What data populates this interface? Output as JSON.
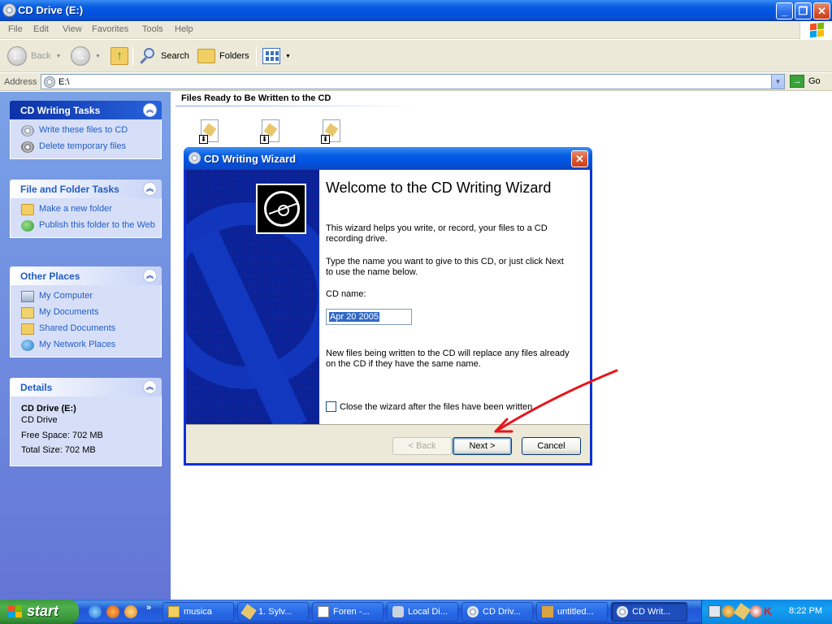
{
  "window": {
    "title": "CD Drive (E:)"
  },
  "menu": [
    "File",
    "Edit",
    "View",
    "Favorites",
    "Tools",
    "Help"
  ],
  "toolbar": {
    "back": "Back",
    "search": "Search",
    "folders": "Folders"
  },
  "address": {
    "label": "Address",
    "value": "E:\\",
    "go": "Go"
  },
  "taskpane": {
    "cd_tasks": {
      "title": "CD Writing Tasks",
      "items": [
        "Write these files to CD",
        "Delete temporary files"
      ]
    },
    "file_tasks": {
      "title": "File and Folder Tasks",
      "items": [
        "Make a new folder",
        "Publish this folder to the Web"
      ]
    },
    "other_places": {
      "title": "Other Places",
      "items": [
        "My Computer",
        "My Documents",
        "Shared Documents",
        "My Network Places"
      ]
    },
    "details": {
      "title": "Details",
      "name": "CD Drive (E:)",
      "type": "CD Drive",
      "free": "Free Space: 702 MB",
      "total": "Total Size: 702 MB"
    }
  },
  "content": {
    "group_header": "Files Ready to Be Written to the CD"
  },
  "wizard": {
    "title": "CD Writing Wizard",
    "heading": "Welcome to the CD Writing Wizard",
    "intro": "This wizard helps you write, or record, your files to a CD recording drive.",
    "instructions": "Type the name you want to give to this CD, or just click Next to use the name below.",
    "cd_name_label": "CD name:",
    "cd_name_value": "Apr 20 2005",
    "warning": "New files being written to the CD will replace any files already on the CD if they have the same name.",
    "close_checkbox": "Close the wizard after the files have been written",
    "close_checked": false,
    "back_button": "< Back",
    "next_button": "Next >",
    "cancel_button": "Cancel"
  },
  "annotation": {
    "color": "#e8141a"
  },
  "taskbar": {
    "start": "start",
    "buttons": [
      "musica",
      "1. Sylv...",
      "Foren -...",
      "Local Di...",
      "CD Driv...",
      "untitled...",
      "CD Writ..."
    ],
    "active_index": 6,
    "clock": "8:22 PM"
  }
}
